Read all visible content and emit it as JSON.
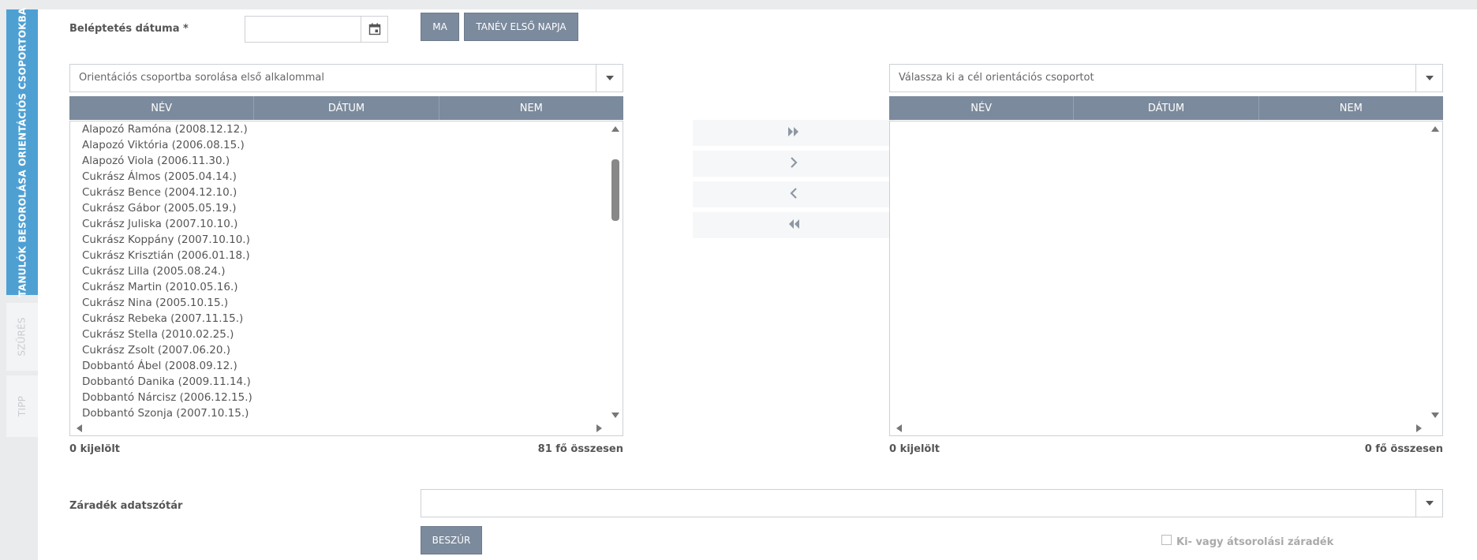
{
  "sidebar": {
    "tabs": [
      {
        "label": "TANULÓK BESOROLÁSA ORIENTÁCIÓS CSOPORTOKBA",
        "active": true
      },
      {
        "label": "SZŰRÉS",
        "active": false
      },
      {
        "label": "TIPP",
        "active": false
      }
    ]
  },
  "form": {
    "date_label": "Beléptetés dátuma *",
    "date_value": "",
    "btn_today": "MA",
    "btn_school_year_start": "TANÉV ELSŐ NAPJA"
  },
  "left_panel": {
    "combo_text": "Orientációs csoportba sorolása első alkalommal",
    "columns": [
      "NÉV",
      "DÁTUM",
      "NEM"
    ],
    "items": [
      "Alapozó Ramóna (2008.12.12.)",
      "Alapozó Viktória (2006.08.15.)",
      "Alapozó Viola (2006.11.30.)",
      "Cukrász Álmos (2005.04.14.)",
      "Cukrász Bence (2004.12.10.)",
      "Cukrász Gábor (2005.05.19.)",
      "Cukrász Juliska (2007.10.10.)",
      "Cukrász Koppány (2007.10.10.)",
      "Cukrász Krisztián (2006.01.18.)",
      "Cukrász Lilla (2005.08.24.)",
      "Cukrász Martin (2010.05.16.)",
      "Cukrász Nina (2005.10.15.)",
      "Cukrász Rebeka (2007.11.15.)",
      "Cukrász Stella (2010.02.25.)",
      "Cukrász Zsolt (2007.06.20.)",
      "Dobbantó Ábel (2008.09.12.)",
      "Dobbantó Danika (2009.11.14.)",
      "Dobbantó Nárcisz (2006.12.15.)",
      "Dobbantó Szonja (2007.10.15.)"
    ],
    "selected_count": "0 kijelölt",
    "total_count": "81 fő összesen"
  },
  "transfer_buttons": {
    "move_all_right": "⏩",
    "move_right": "›",
    "move_left": "‹",
    "move_all_left": "⏪"
  },
  "right_panel": {
    "combo_text": "Válassza ki a cél orientációs csoportot",
    "columns": [
      "NÉV",
      "DÁTUM",
      "NEM"
    ],
    "selected_count": "0 kijelölt",
    "total_count": "0 fő összesen"
  },
  "clause": {
    "label": "Záradék adatszótár",
    "value": "",
    "insert_button": "BESZÚR",
    "checkbox_label": "Ki- vagy átsorolási záradék"
  },
  "colors": {
    "active_tab": "#4ea0d3",
    "header_bg": "#7b8a9c",
    "page_bg": "#e9ebed"
  }
}
